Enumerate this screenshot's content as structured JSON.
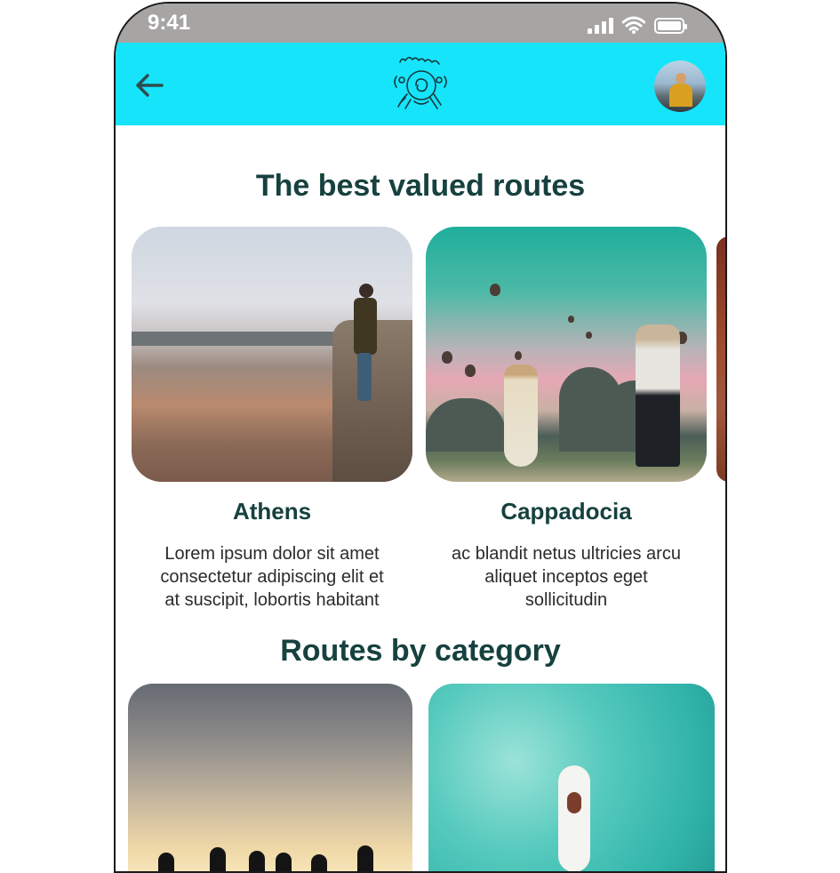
{
  "status_bar": {
    "time": "9:41"
  },
  "header": {
    "back_icon": "arrow-left-icon",
    "logo": "bikers-logo",
    "avatar": "user-avatar"
  },
  "best_routes": {
    "title": "The best valued routes",
    "cards": [
      {
        "name": "Athens",
        "description_lines": [
          "Lorem ipsum dolor sit amet",
          "consectetur adipiscing elit et",
          "at suscipit, lobortis habitant"
        ]
      },
      {
        "name": "Cappadocia",
        "description_lines": [
          "ac blandit netus ultricies arcu",
          "aliquet inceptos eget",
          "sollicitudin"
        ]
      }
    ]
  },
  "categories": {
    "title": "Routes by category"
  },
  "colors": {
    "header_bg": "#16e4fb",
    "status_bar_bg": "#a7a4a4",
    "title_color": "#16413f"
  }
}
